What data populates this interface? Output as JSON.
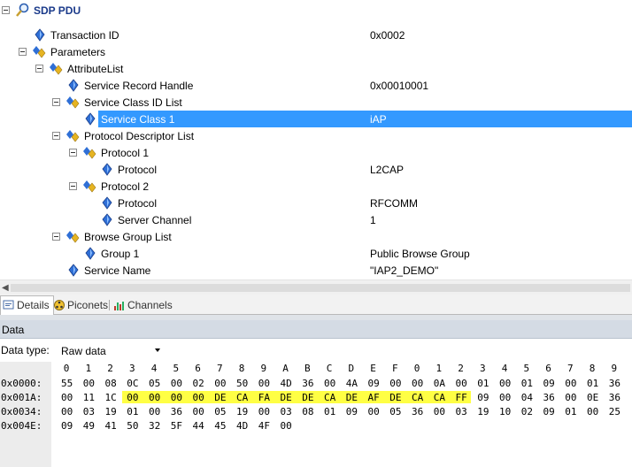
{
  "tree": {
    "root_label": "SDP PDU",
    "rows": [
      {
        "label": "Transaction ID",
        "value": "0x0002"
      },
      {
        "label": "Parameters",
        "value": ""
      },
      {
        "label": "AttributeList",
        "value": ""
      },
      {
        "label": "Service Record Handle",
        "value": "0x00010001"
      },
      {
        "label": "Service Class ID List",
        "value": ""
      },
      {
        "label": "Service Class 1",
        "value": "iAP"
      },
      {
        "label": "Protocol Descriptor List",
        "value": ""
      },
      {
        "label": "Protocol 1",
        "value": ""
      },
      {
        "label": "Protocol",
        "value": "L2CAP"
      },
      {
        "label": "Protocol 2",
        "value": ""
      },
      {
        "label": "Protocol",
        "value": "RFCOMM"
      },
      {
        "label": "Server Channel",
        "value": "1"
      },
      {
        "label": "Browse Group List",
        "value": ""
      },
      {
        "label": "Group 1",
        "value": "Public Browse Group"
      },
      {
        "label": "Service Name",
        "value": "\"IAP2_DEMO\""
      }
    ]
  },
  "tabs": [
    {
      "label": "Details",
      "active": true
    },
    {
      "label": "Piconets",
      "active": false
    },
    {
      "label": "Channels",
      "active": false
    }
  ],
  "data_panel": {
    "header": "Data",
    "data_type_label": "Data type:",
    "data_type_value": "Raw data",
    "column_headers": [
      "0",
      "1",
      "2",
      "3",
      "4",
      "5",
      "6",
      "7",
      "8",
      "9",
      "A",
      "B",
      "C",
      "D",
      "E",
      "F",
      "0",
      "1",
      "2",
      "3",
      "4",
      "5",
      "6",
      "7",
      "8",
      "9"
    ],
    "rows": [
      {
        "address": "0x0000:",
        "bytes": [
          "55",
          "00",
          "08",
          "0C",
          "05",
          "00",
          "02",
          "00",
          "50",
          "00",
          "4D",
          "36",
          "00",
          "4A",
          "09",
          "00",
          "00",
          "0A",
          "00",
          "01",
          "00",
          "01",
          "09",
          "00",
          "01",
          "36"
        ]
      },
      {
        "address": "0x001A:",
        "bytes": [
          "00",
          "11",
          "1C",
          "00",
          "00",
          "00",
          "00",
          "DE",
          "CA",
          "FA",
          "DE",
          "DE",
          "CA",
          "DE",
          "AF",
          "DE",
          "CA",
          "CA",
          "FF",
          "09",
          "00",
          "04",
          "36",
          "00",
          "0E",
          "36"
        ]
      },
      {
        "address": "0x0034:",
        "bytes": [
          "00",
          "03",
          "19",
          "01",
          "00",
          "36",
          "00",
          "05",
          "19",
          "00",
          "03",
          "08",
          "01",
          "09",
          "00",
          "05",
          "36",
          "00",
          "03",
          "19",
          "10",
          "02",
          "09",
          "01",
          "00",
          "25"
        ]
      },
      {
        "address": "0x004E:",
        "bytes": [
          "09",
          "49",
          "41",
          "50",
          "32",
          "5F",
          "44",
          "45",
          "4D",
          "4F",
          "00"
        ]
      }
    ],
    "highlight": {
      "row": 1,
      "start": 3,
      "end": 18,
      "color": "#ffff44"
    }
  },
  "colors": {
    "selection": "#3399ff",
    "highlight": "#ffff44",
    "header_bg": "#d4dbe4"
  }
}
